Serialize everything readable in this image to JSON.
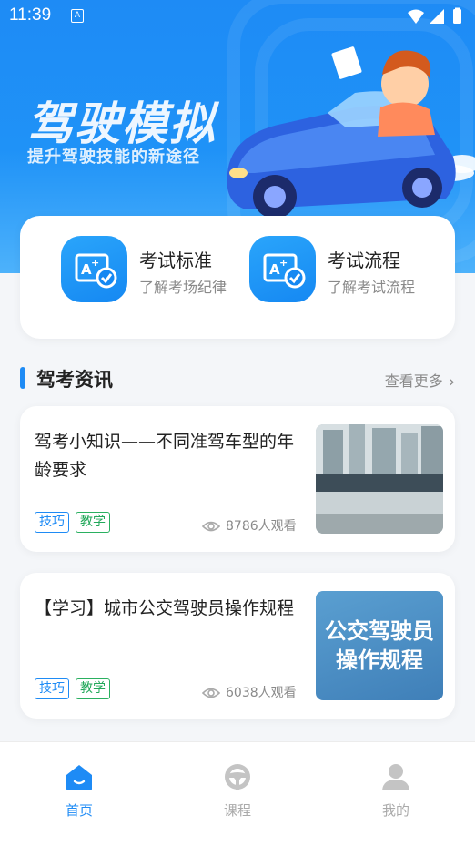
{
  "status_bar": {
    "time": "11:39",
    "app_icon": "A"
  },
  "hero": {
    "title": "驾驶模拟",
    "subtitle": "提升驾驶技能的新途径"
  },
  "quick_links": [
    {
      "title": "考试标准",
      "subtitle": "了解考场纪律",
      "icon": "exam-icon"
    },
    {
      "title": "考试流程",
      "subtitle": "了解考试流程",
      "icon": "exam-icon"
    }
  ],
  "section": {
    "title": "驾考资讯",
    "more": "查看更多"
  },
  "news": [
    {
      "title": "驾考小知识——不同准驾车型的年龄要求",
      "tags": [
        "技巧",
        "教学"
      ],
      "views": "8786人观看"
    },
    {
      "title": "【学习】城市公交驾驶员操作规程",
      "tags": [
        "技巧",
        "教学"
      ],
      "views": "6038人观看",
      "thumb_text_1": "公交驾驶员",
      "thumb_text_2": "操作规程"
    }
  ],
  "tabbar": {
    "items": [
      {
        "label": "首页"
      },
      {
        "label": "课程"
      },
      {
        "label": "我的"
      }
    ]
  },
  "colors": {
    "primary": "#1e8bf5",
    "tag_blue": "#1e8bf5",
    "tag_green": "#22a85a"
  }
}
